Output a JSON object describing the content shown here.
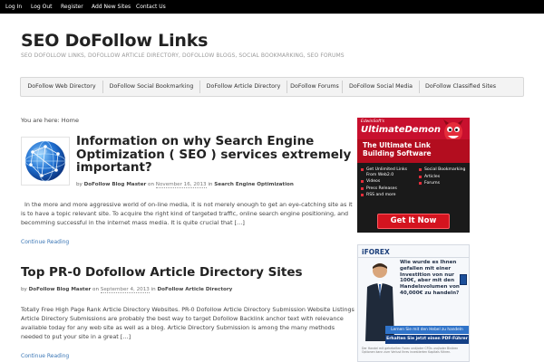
{
  "topbar": {
    "links": [
      "Log In",
      "Log Out",
      "Register",
      "Add New Sites",
      "Contact Us"
    ]
  },
  "header": {
    "title": "SEO DoFollow Links",
    "description": "SEO dofollow Links, dofollow article directory, dofollow blogs, social bookmarking, seo forums"
  },
  "nav": {
    "items": [
      "DoFollow Web Directory",
      "DoFollow Social Bookmarking",
      "DoFollow Article Directory",
      "DoFollow Forums",
      "DoFollow Social Media",
      "DoFollow Classified Sites"
    ]
  },
  "breadcrumb": "You are here: Home",
  "posts": [
    {
      "title": "Information on why Search Engine Optimization ( SEO ) services extremely important?",
      "by": "by",
      "author": "DoFollow Blog Master",
      "on": "on",
      "date": "November 16, 2013",
      "in": "in",
      "category": "Search Engine Optimization",
      "excerpt": "In the more and more aggressive world of on-line media, it is not merely enough to get an eye-catching site as it is to have a topic relevant site. To acquire the right kind of targeted traffic, online search engine positioning, and becomming successful in the internet mass media. It is quite crucial that […]",
      "readmore": "Continue Reading"
    },
    {
      "title": "Top PR-0 Dofollow Article Directory Sites",
      "by": "by",
      "author": "DoFollow Blog Master",
      "on": "on",
      "date": "September 4, 2013",
      "in": "in",
      "category": "DoFollow Article Directory",
      "excerpt": "Totally Free High Page Rank Article Directory Websites. PR-0 Dofollow Article Directory Submission Website Listings Article Directory Submissions are probably the best way to target Dofollow Backlink anchor text with relevance available today for any web site as well as a blog. Article Directory Submission is among the many methods needed to put your site in a great […]",
      "readmore": "Continue Reading"
    }
  ],
  "ad1": {
    "brand": "EdwinSoft's",
    "product": "UltimateDemon",
    "headline": "The Ultimate Link Building Software",
    "features_left": [
      "Get Unlimited Links From Web2.0",
      "Videos",
      "Press Releases",
      "RSS and more"
    ],
    "features_right": [
      "Social Bookmarking",
      "Articles",
      "Forums"
    ],
    "cta": "Get It Now"
  },
  "ad2": {
    "brand": "iFOREX",
    "text": "Wie wurde es Ihnen gefallen mit einer Investition von nur 100€, aber mit den Handelsvolumen von 40,000€ zu handeln?",
    "cta1": "Lernen Sie mit den Hebel zu handeln",
    "cta2": "Erhalten Sie jetzt einen PDF-Führer",
    "disclaimer": "Der Handel mit gehebelten Forex und/oder CFDs und/oder Binären Optionen kann zum Verlust Ihres investierten Kapitals führen."
  },
  "colors": {
    "link": "#3a76b5",
    "topbar": "#000000",
    "accent_red": "#c8102e"
  }
}
